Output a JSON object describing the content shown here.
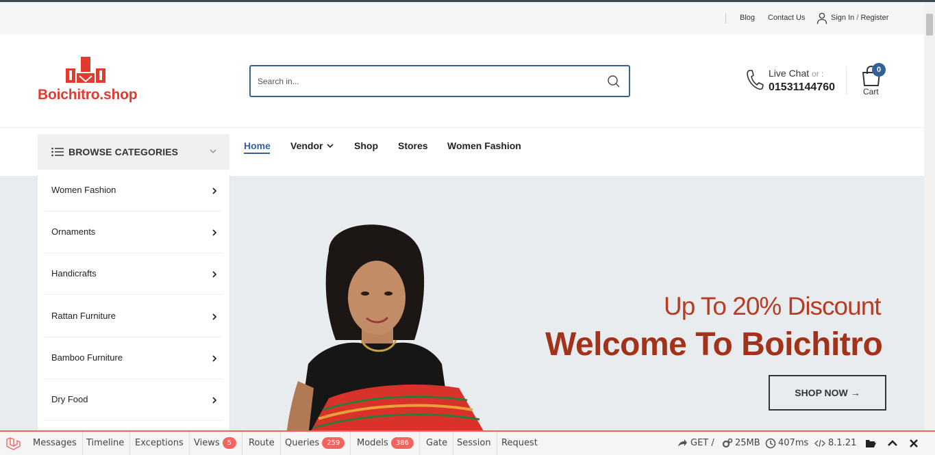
{
  "topbar": {
    "blog": "Blog",
    "contact": "Contact Us",
    "signin": "Sign In",
    "slash": "/",
    "register": "Register"
  },
  "brand": {
    "name": "Boichitro.shop",
    "color": "#e23a2e"
  },
  "search": {
    "placeholder": "Search in..."
  },
  "contact": {
    "live_chat": "Live Chat",
    "or": "or :",
    "phone": "01531144760"
  },
  "cart": {
    "count": "0",
    "label": "Cart"
  },
  "browse": {
    "label": "BROWSE CATEGORIES"
  },
  "nav": {
    "items": [
      {
        "label": "Home"
      },
      {
        "label": "Vendor"
      },
      {
        "label": "Shop"
      },
      {
        "label": "Stores"
      },
      {
        "label": "Women Fashion"
      }
    ]
  },
  "categories": [
    {
      "label": "Women Fashion"
    },
    {
      "label": "Ornaments"
    },
    {
      "label": "Handicrafts"
    },
    {
      "label": "Rattan Furniture"
    },
    {
      "label": "Bamboo Furniture"
    },
    {
      "label": "Dry Food"
    }
  ],
  "hero": {
    "subtitle": "Up To 20% Discount",
    "title": "Welcome To Boichitro",
    "cta": "SHOP NOW"
  },
  "debugbar": {
    "tabs": [
      {
        "label": "Messages"
      },
      {
        "label": "Timeline"
      },
      {
        "label": "Exceptions"
      },
      {
        "label": "Views",
        "badge": "5"
      },
      {
        "label": "Route"
      },
      {
        "label": "Queries",
        "badge": "259"
      },
      {
        "label": "Models",
        "badge": "386"
      },
      {
        "label": "Gate"
      },
      {
        "label": "Session"
      },
      {
        "label": "Request"
      }
    ],
    "method": "GET /",
    "memory": "25MB",
    "time": "407ms",
    "php": "8.1.21"
  },
  "colors": {
    "accent": "#336199",
    "hero_text": "#a3321a",
    "debug_accent": "#f4645f"
  }
}
